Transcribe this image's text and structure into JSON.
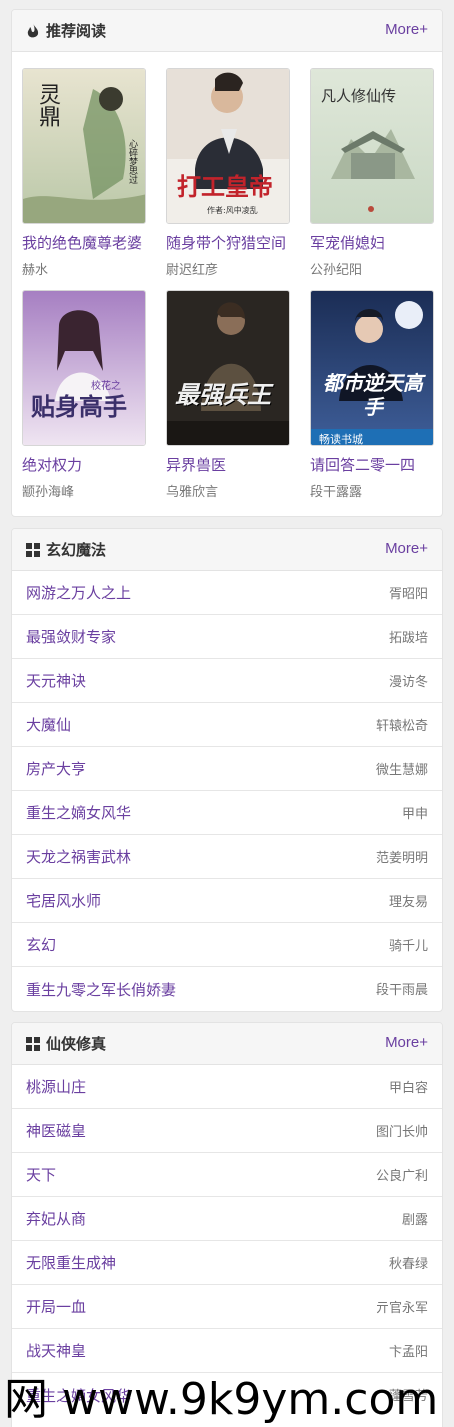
{
  "recommend": {
    "title": "推荐阅读",
    "more": "More+",
    "books": [
      {
        "title": "我的绝色魔尊老婆",
        "author": "赫水",
        "cover_text": "灵鼎",
        "cover_sub": "心碎梦思过"
      },
      {
        "title": "随身带个狩猎空间",
        "author": "尉迟红彦",
        "cover_text": "打工皇帝",
        "cover_sub": "作者:风中凌乱"
      },
      {
        "title": "军宠俏媳妇",
        "author": "公孙纪阳",
        "cover_text": "凡人修仙传",
        "cover_sub": ""
      },
      {
        "title": "绝对权力",
        "author": "颛孙海峰",
        "cover_text": "贴身高手",
        "cover_sub": "校花之"
      },
      {
        "title": "异界兽医",
        "author": "乌雅欣言",
        "cover_text": "最强兵王",
        "cover_sub": ""
      },
      {
        "title": "请回答二零一四",
        "author": "段干露露",
        "cover_text": "都市逆天高手",
        "cover_sub": "畅读书城"
      }
    ]
  },
  "fantasy": {
    "title": "玄幻魔法",
    "more": "More+",
    "items": [
      {
        "title": "网游之万人之上",
        "author": "胥昭阳"
      },
      {
        "title": "最强敛财专家",
        "author": "拓跋培"
      },
      {
        "title": "天元神诀",
        "author": "漫访冬"
      },
      {
        "title": "大魔仙",
        "author": "轩辕松奇"
      },
      {
        "title": "房产大亨",
        "author": "微生慧娜"
      },
      {
        "title": "重生之嫡女风华",
        "author": "甲申"
      },
      {
        "title": "天龙之祸害武林",
        "author": "范姜明明"
      },
      {
        "title": "宅居风水师",
        "author": "理友易"
      },
      {
        "title": "玄幻",
        "author": "骑千儿"
      },
      {
        "title": "重生九零之军长俏娇妻",
        "author": "段干雨晨"
      }
    ]
  },
  "xianxia": {
    "title": "仙侠修真",
    "more": "More+",
    "items": [
      {
        "title": "桃源山庄",
        "author": "甲白容"
      },
      {
        "title": "神医磁皇",
        "author": "图门长帅"
      },
      {
        "title": "天下",
        "author": "公良广利"
      },
      {
        "title": "弃妃从商",
        "author": "剧露"
      },
      {
        "title": "无限重生成神",
        "author": "秋春绿"
      },
      {
        "title": "开局一血",
        "author": "亓官永军"
      },
      {
        "title": "战天神皇",
        "author": "卞孟阳"
      },
      {
        "title": "重生之嫡女风华",
        "author": "蓬雪芳"
      }
    ]
  },
  "watermark": "网 www.9k9ym.com",
  "colors": {
    "accent": "#6a3fa0",
    "muted": "#777777"
  }
}
